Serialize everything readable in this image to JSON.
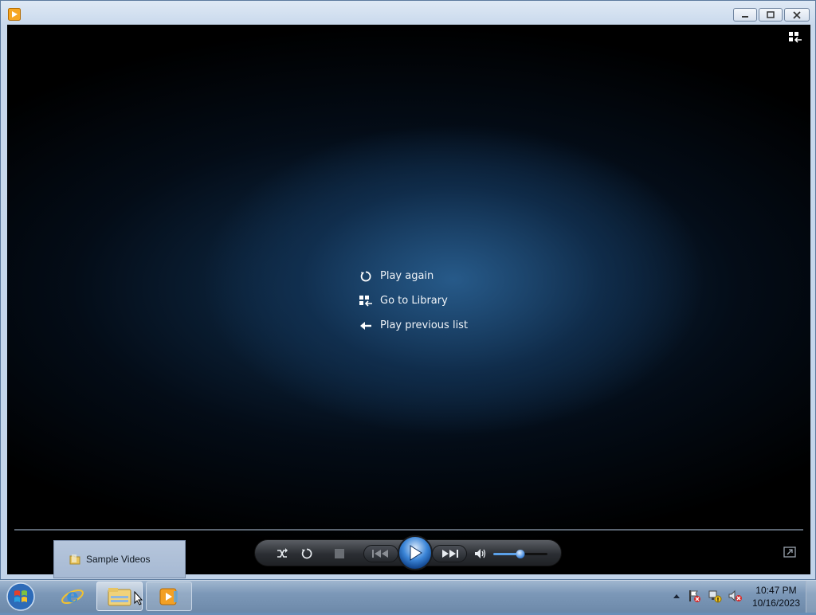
{
  "window": {
    "controls": {
      "minimize_icon": "minimize-icon",
      "maximize_icon": "restore-icon",
      "close_icon": "close-icon"
    }
  },
  "player": {
    "menu": [
      {
        "label": "Play again",
        "icon": "replay-icon"
      },
      {
        "label": "Go to Library",
        "icon": "library-icon"
      },
      {
        "label": "Play previous list",
        "icon": "back-arrow-icon"
      }
    ],
    "volume_level": 0.5
  },
  "popup": {
    "label": "Sample Videos"
  },
  "taskbar": {
    "clock_time": "10:47 PM",
    "clock_date": "10/16/2023"
  },
  "colors": {
    "accent": "#3c86d8",
    "player_bg": "#000000",
    "taskbar": "#7c98b8"
  }
}
